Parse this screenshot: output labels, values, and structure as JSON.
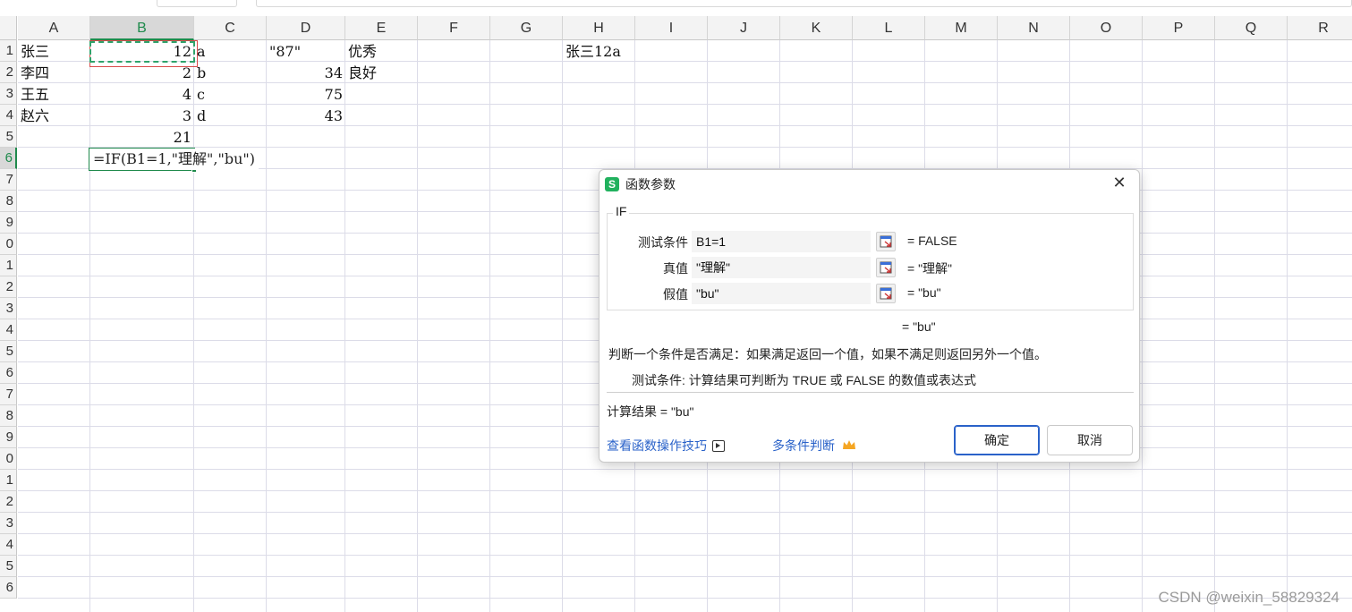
{
  "sheet": {
    "columns": [
      "A",
      "B",
      "C",
      "D",
      "E",
      "F",
      "G",
      "H",
      "I",
      "J",
      "K",
      "L",
      "M",
      "N",
      "O",
      "P",
      "Q",
      "R"
    ],
    "selected_column": "B",
    "row_labels": [
      "1",
      "2",
      "3",
      "4",
      "5",
      "6",
      "7",
      "8",
      "9",
      "0",
      "1",
      "2",
      "3",
      "4",
      "5",
      "6",
      "7",
      "8",
      "9",
      "0",
      "1",
      "2",
      "3",
      "4",
      "5",
      "6"
    ],
    "selected_row": "6",
    "cells": {
      "A1": "张三",
      "B1": "12",
      "C1": "a",
      "D1": "\"87\"",
      "E1": "优秀",
      "H1": "张三12a",
      "A2": "李四",
      "B2": "2",
      "C2": "b",
      "D2": "34",
      "E2": "良好",
      "A3": "王五",
      "B3": "4",
      "C3": "c",
      "D3": "75",
      "A4": "赵六",
      "B4": "3",
      "C4": "d",
      "D4": "43",
      "B5": "21"
    },
    "active_formula": "=IF(B1=1,\"理解\",\"bu\")"
  },
  "dialog": {
    "title": "函数参数",
    "close_icon": "close-icon",
    "function_name": "IF",
    "args": [
      {
        "label": "测试条件",
        "value": "B1=1",
        "result": "= FALSE"
      },
      {
        "label": "真值",
        "value": "\"理解\"",
        "result": "= \"理解\""
      },
      {
        "label": "假值",
        "value": "\"bu\"",
        "result": "= \"bu\""
      }
    ],
    "formula_result": "= \"bu\"",
    "description": "判断一个条件是否满足：如果满足返回一个值，如果不满足则返回另外一个值。",
    "arg_description": "测试条件:  计算结果可判断为 TRUE 或 FALSE 的数值或表达式",
    "calc_result": "计算结果 = \"bu\"",
    "link_tips": "查看函数操作技巧",
    "link_multi": "多条件判断",
    "ok_label": "确定",
    "cancel_label": "取消",
    "brand_color": "#21b15e",
    "link_color": "#2a62c9",
    "crown_color": "#f5a623"
  },
  "watermark": "CSDN @weixin_58829324"
}
